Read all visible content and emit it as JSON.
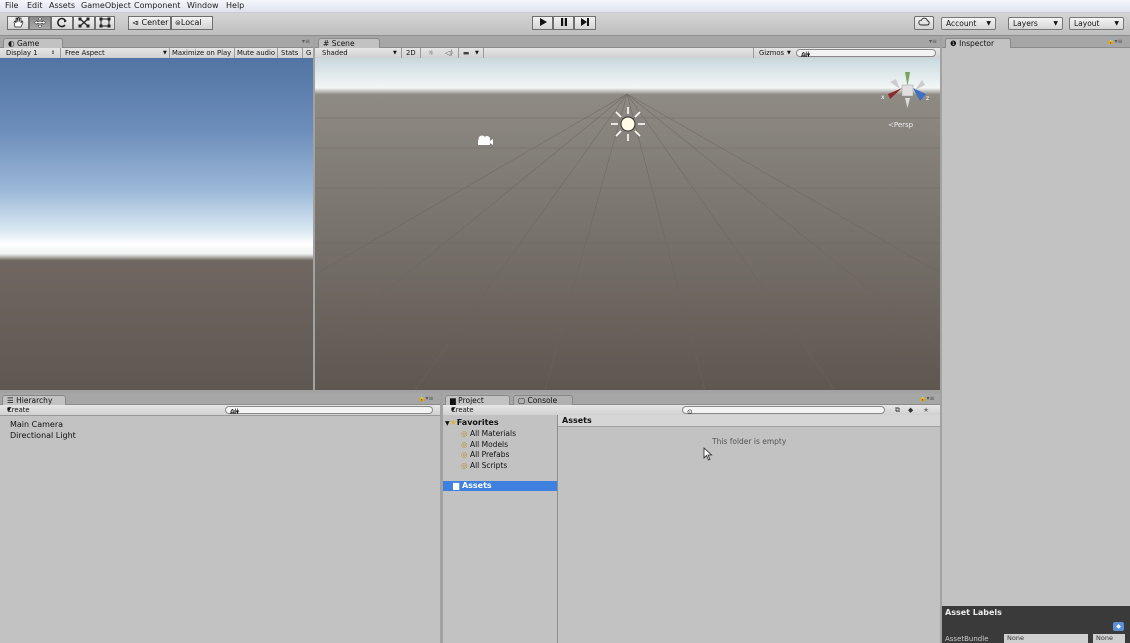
{
  "menu": [
    "File",
    "Edit",
    "Assets",
    "GameObject",
    "Component",
    "Window",
    "Help"
  ],
  "toolbar": {
    "center_label": "Center",
    "local_label": "Local",
    "account_label": "Account",
    "layers_label": "Layers",
    "layout_label": "Layout"
  },
  "game": {
    "tab_label": "Game",
    "display": "Display 1",
    "aspect": "Free Aspect",
    "maximize": "Maximize on Play",
    "mute": "Mute audio",
    "stats": "Stats",
    "gizmos_trunc": "G"
  },
  "scene": {
    "tab_label": "Scene",
    "shading": "Shaded",
    "mode2d": "2D",
    "gizmos": "Gizmos",
    "search_placeholder": "All",
    "persp": "Persp",
    "axis_x": "x",
    "axis_z": "z"
  },
  "inspector": {
    "tab_label": "Inspector",
    "asset_labels": "Asset Labels",
    "assetbundle_label": "AssetBundle",
    "assetbundle_value": "None",
    "assetbundle_variant": "None"
  },
  "hierarchy": {
    "tab_label": "Hierarchy",
    "create_label": "Create",
    "search_placeholder": "All",
    "items": [
      "Main Camera",
      "Directional Light"
    ]
  },
  "project": {
    "tab_label": "Project",
    "console_tab": "Console",
    "create_label": "Create",
    "favorites_label": "Favorites",
    "favorites": [
      "All Materials",
      "All Models",
      "All Prefabs",
      "All Scripts"
    ],
    "assets_label": "Assets",
    "breadcrumb": "Assets",
    "empty_message": "This folder is empty"
  }
}
